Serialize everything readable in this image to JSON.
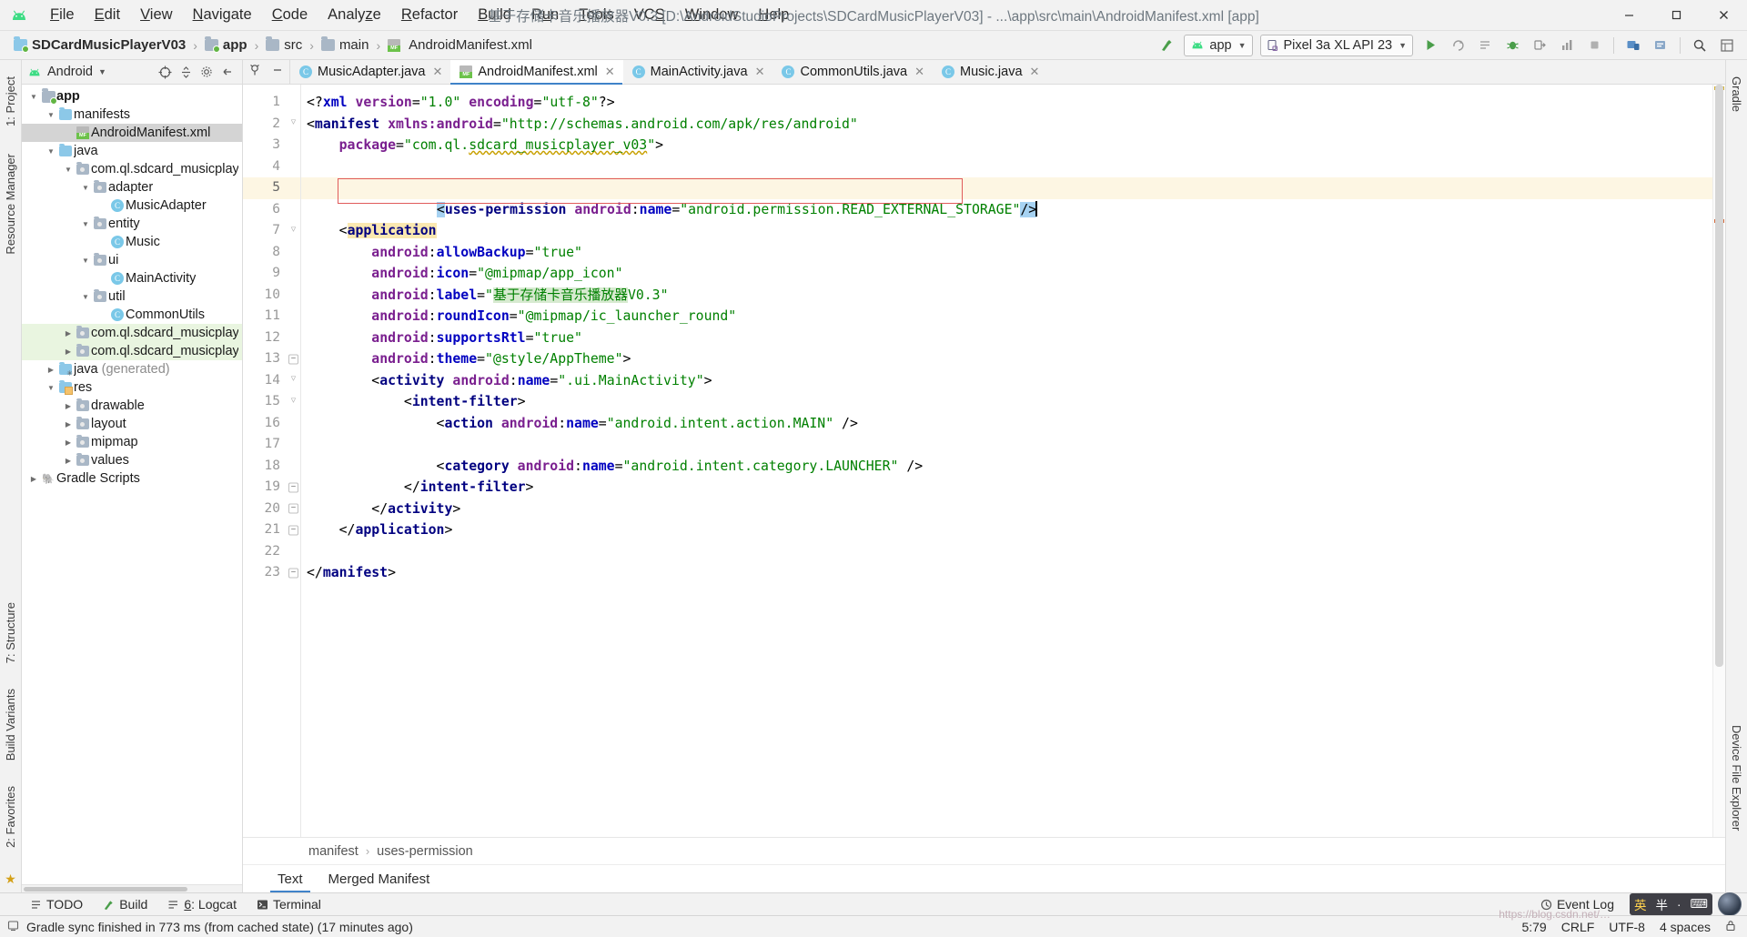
{
  "window": {
    "title": "基于存储卡音乐播放器V0.3 [D:\\AndroidStudioProjects\\SDCardMusicPlayerV03] - ...\\app\\src\\main\\AndroidManifest.xml [app]",
    "minimize": "—",
    "maximize": "❐",
    "close": "✕"
  },
  "menubar": {
    "items": [
      {
        "label": "File"
      },
      {
        "label": "Edit"
      },
      {
        "label": "View"
      },
      {
        "label": "Navigate"
      },
      {
        "label": "Code"
      },
      {
        "label": "Analyze"
      },
      {
        "label": "Refactor"
      },
      {
        "label": "Build"
      },
      {
        "label": "Run"
      },
      {
        "label": "Tools"
      },
      {
        "label": "VCS"
      },
      {
        "label": "Window"
      },
      {
        "label": "Help"
      }
    ]
  },
  "breadcrumb": {
    "items": [
      {
        "label": "SDCardMusicPlayerV03",
        "icon": "folder-icon"
      },
      {
        "label": "app",
        "icon": "module-icon"
      },
      {
        "label": "src",
        "icon": "folder-icon"
      },
      {
        "label": "main",
        "icon": "folder-icon"
      },
      {
        "label": "AndroidManifest.xml",
        "icon": "manifest-icon"
      }
    ],
    "separator": "›"
  },
  "toolbar": {
    "build_hammer": "build-icon",
    "run_config": "app",
    "device": "Pixel 3a XL API 23",
    "caret": "▾",
    "icons": [
      "run-icon",
      "apply-changes-icon",
      "apply-code-changes-icon",
      "debug-icon",
      "attach-debugger-icon",
      "profiler-icon",
      "stop-icon",
      "avd-manager-icon",
      "sdk-manager-icon",
      "search-icon",
      "layout-inspector-icon"
    ]
  },
  "project_panel": {
    "title": "Android",
    "caret": "▾",
    "header_icons": [
      "target-icon",
      "collapse-all-icon",
      "settings-icon",
      "hide-icon"
    ],
    "tree": [
      {
        "label": "app",
        "depth": 0,
        "arrow": "▼",
        "icon": "module-icon",
        "bold": true,
        "state": "normal"
      },
      {
        "label": "manifests",
        "depth": 1,
        "arrow": "▼",
        "icon": "folder-blue-icon",
        "bold": false,
        "state": "normal"
      },
      {
        "label": "AndroidManifest.xml",
        "depth": 2,
        "arrow": "",
        "icon": "manifest-icon",
        "bold": false,
        "state": "selected"
      },
      {
        "label": "java",
        "depth": 1,
        "arrow": "▼",
        "icon": "folder-blue-icon",
        "bold": false,
        "state": "normal"
      },
      {
        "label": "com.ql.sdcard_musicplayer_",
        "depth": 2,
        "arrow": "▼",
        "icon": "package-icon",
        "bold": false,
        "state": "normal"
      },
      {
        "label": "adapter",
        "depth": 3,
        "arrow": "▼",
        "icon": "package-icon",
        "bold": false,
        "state": "normal"
      },
      {
        "label": "MusicAdapter",
        "depth": 4,
        "arrow": "",
        "icon": "class-icon",
        "bold": false,
        "state": "normal"
      },
      {
        "label": "entity",
        "depth": 3,
        "arrow": "▼",
        "icon": "package-icon",
        "bold": false,
        "state": "normal"
      },
      {
        "label": "Music",
        "depth": 4,
        "arrow": "",
        "icon": "class-icon",
        "bold": false,
        "state": "normal"
      },
      {
        "label": "ui",
        "depth": 3,
        "arrow": "▼",
        "icon": "package-icon",
        "bold": false,
        "state": "normal"
      },
      {
        "label": "MainActivity",
        "depth": 4,
        "arrow": "",
        "icon": "class-icon",
        "bold": false,
        "state": "normal"
      },
      {
        "label": "util",
        "depth": 3,
        "arrow": "▼",
        "icon": "package-icon",
        "bold": false,
        "state": "normal"
      },
      {
        "label": "CommonUtils",
        "depth": 4,
        "arrow": "",
        "icon": "class-icon",
        "bold": false,
        "state": "normal"
      },
      {
        "label": "com.ql.sdcard_musicplayer_",
        "depth": 2,
        "arrow": "▶",
        "icon": "package-icon",
        "bold": false,
        "state": "green"
      },
      {
        "label": "com.ql.sdcard_musicplayer_",
        "depth": 2,
        "arrow": "▶",
        "icon": "package-icon",
        "bold": false,
        "state": "green"
      },
      {
        "label": "java (generated)",
        "depth": 1,
        "arrow": "▶",
        "icon": "folder-generated-icon",
        "bold": false,
        "state": "normal"
      },
      {
        "label": "res",
        "depth": 1,
        "arrow": "▼",
        "icon": "folder-res-icon",
        "bold": false,
        "state": "normal"
      },
      {
        "label": "drawable",
        "depth": 2,
        "arrow": "▶",
        "icon": "package-icon",
        "bold": false,
        "state": "normal"
      },
      {
        "label": "layout",
        "depth": 2,
        "arrow": "▶",
        "icon": "package-icon",
        "bold": false,
        "state": "normal"
      },
      {
        "label": "mipmap",
        "depth": 2,
        "arrow": "▶",
        "icon": "package-icon",
        "bold": false,
        "state": "normal"
      },
      {
        "label": "values",
        "depth": 2,
        "arrow": "▶",
        "icon": "package-icon",
        "bold": false,
        "state": "normal"
      },
      {
        "label": "Gradle Scripts",
        "depth": 0,
        "arrow": "▶",
        "icon": "gradle-icon",
        "bold": false,
        "state": "normal"
      }
    ]
  },
  "left_strip": {
    "tabs": [
      "1: Project",
      "Resource Manager",
      "7: Structure",
      "Build Variants",
      "2: Favorites"
    ]
  },
  "right_strip": {
    "tabs": [
      "Gradle",
      "Device File Explorer"
    ]
  },
  "editor_tabs": [
    {
      "label": "MusicAdapter.java",
      "icon": "java-class-icon",
      "active": false
    },
    {
      "label": "AndroidManifest.xml",
      "icon": "manifest-icon",
      "active": true
    },
    {
      "label": "MainActivity.java",
      "icon": "java-class-icon",
      "active": false
    },
    {
      "label": "CommonUtils.java",
      "icon": "java-class-icon",
      "active": false
    },
    {
      "label": "Music.java",
      "icon": "java-class-icon",
      "active": false
    }
  ],
  "editor": {
    "line_numbers": [
      1,
      2,
      3,
      4,
      5,
      6,
      7,
      8,
      9,
      10,
      11,
      12,
      13,
      14,
      15,
      16,
      17,
      18,
      19,
      20,
      21,
      22,
      23
    ],
    "current_line": 5,
    "lines": [
      "<?xml version=\"1.0\" encoding=\"utf-8\"?>",
      "<manifest xmlns:android=\"http://schemas.android.com/apk/res/android\"",
      "    package=\"com.ql.sdcard_musicplayer_v03\">",
      "",
      "    <uses-permission android:name=\"android.permission.READ_EXTERNAL_STORAGE\"/>",
      "",
      "    <application",
      "        android:allowBackup=\"true\"",
      "        android:icon=\"@mipmap/app_icon\"",
      "        android:label=\"基于存储卡音乐播放器V0.3\"",
      "        android:roundIcon=\"@mipmap/ic_launcher_round\"",
      "        android:supportsRtl=\"true\"",
      "        android:theme=\"@style/AppTheme\">",
      "        <activity android:name=\".ui.MainActivity\">",
      "            <intent-filter>",
      "                <action android:name=\"android.intent.action.MAIN\" />",
      "",
      "                <category android:name=\"android.intent.category.LAUNCHER\" />",
      "            </intent-filter>",
      "        </activity>",
      "    </application>",
      "",
      "</manifest>"
    ]
  },
  "editor_crumbs": {
    "items": [
      "manifest",
      "uses-permission"
    ],
    "separator": "›"
  },
  "view_tabs": [
    {
      "label": "Text",
      "active": true
    },
    {
      "label": "Merged Manifest",
      "active": false
    }
  ],
  "tool_windows": [
    {
      "label": "TODO",
      "icon": "todo-icon"
    },
    {
      "label": "Build",
      "icon": "build-icon"
    },
    {
      "label": "6: Logcat",
      "icon": "logcat-icon"
    },
    {
      "label": "Terminal",
      "icon": "terminal-icon"
    }
  ],
  "event_log": {
    "label": "Event Log",
    "icon": "event-log-icon"
  },
  "ime": {
    "cells": [
      "英",
      "半",
      "·",
      "⌨"
    ]
  },
  "statusbar": {
    "message": "Gradle sync finished in 773 ms (from cached state) (17 minutes ago)",
    "caret_position": "5:79",
    "line_separator": "CRLF",
    "encoding": "UTF-8",
    "indent": "4 spaces",
    "lock_icon": "lock-icon",
    "memory_icon": "memory-icon"
  },
  "colors": {
    "accent_blue": "#4083c9",
    "android_green": "#3ddc84",
    "tag": "#000080",
    "attr": "#7a1f8f",
    "string": "#008000",
    "error_red": "#e05b5b",
    "selected_row": "#d4d4d4",
    "highlight_line": "#fdf6e3"
  }
}
